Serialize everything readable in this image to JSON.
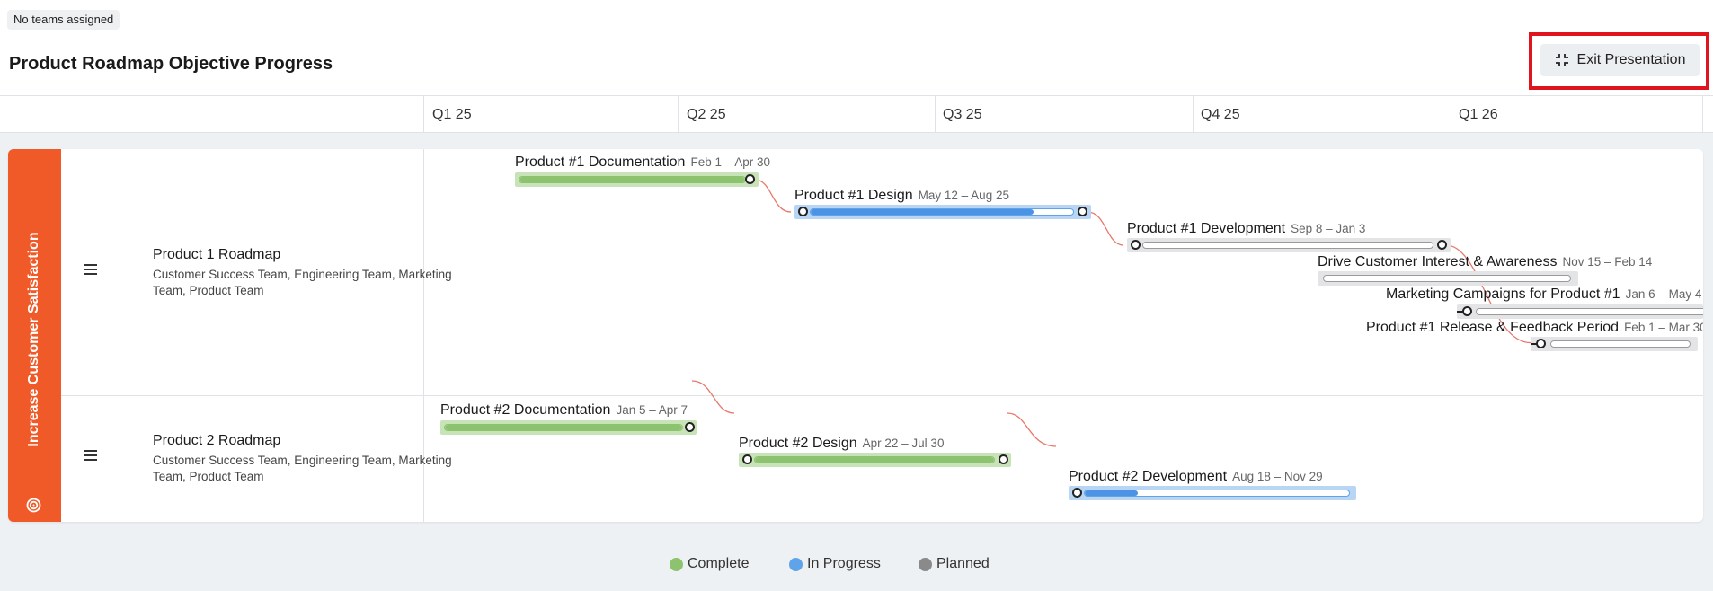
{
  "badge": "No teams assigned",
  "page_title": "Product Roadmap Objective Progress",
  "exit_button": {
    "label": "Exit Presentation",
    "icon": "collapse-icon"
  },
  "quarters": [
    "Q1 25",
    "Q2 25",
    "Q3 25",
    "Q4 25",
    "Q1 26"
  ],
  "objective": {
    "label": "Increase Customer Satisfaction",
    "icon": "target-icon",
    "color": "#f05a28"
  },
  "rows": [
    {
      "title": "Product 1 Roadmap",
      "teams": "Customer Success Team, Engineering Team, Marketing Team, Product Team"
    },
    {
      "title": "Product 2 Roadmap",
      "teams": "Customer Success Team, Engineering Team, Marketing Team, Product Team"
    }
  ],
  "items": [
    {
      "title": "Product #1 Documentation",
      "dates": "Feb 1 – Apr 30",
      "status": "complete",
      "progress": 1.0
    },
    {
      "title": "Product #1 Design",
      "dates": "May 12 – Aug 25",
      "status": "in-progress",
      "progress": 0.85
    },
    {
      "title": "Product #1 Development",
      "dates": "Sep 8 – Jan 3",
      "status": "planned",
      "progress": 0
    },
    {
      "title": "Drive Customer Interest & Awareness",
      "dates": "Nov 15 – Feb 14",
      "status": "planned",
      "progress": 0
    },
    {
      "title": "Marketing Campaigns for Product #1",
      "dates": "Jan 6 – May 4",
      "status": "planned",
      "progress": 0
    },
    {
      "title": "Product #1 Release & Feedback Period",
      "dates": "Feb 1 – Mar 30",
      "status": "planned",
      "progress": 0
    },
    {
      "title": "Product #2 Documentation",
      "dates": "Jan 5 – Apr 7",
      "status": "complete",
      "progress": 1.0
    },
    {
      "title": "Product #2 Design",
      "dates": "Apr 22 – Jul 30",
      "status": "complete",
      "progress": 1.0
    },
    {
      "title": "Product #2 Development",
      "dates": "Aug 18 – Nov 29",
      "status": "in-progress",
      "progress": 0.2
    }
  ],
  "legend": [
    {
      "label": "Complete",
      "color": "#8dc26f"
    },
    {
      "label": "In Progress",
      "color": "#5fa3e8"
    },
    {
      "label": "Planned",
      "color": "#8a8a8a"
    }
  ],
  "colors": {
    "complete_bg": "#c9e3b8",
    "complete_fill": "#8dc26f",
    "progress_bg": "#b8d6f4",
    "progress_fill": "#4c93e6",
    "planned_bg": "#e2e4e6",
    "dependency": "#e8786a"
  }
}
